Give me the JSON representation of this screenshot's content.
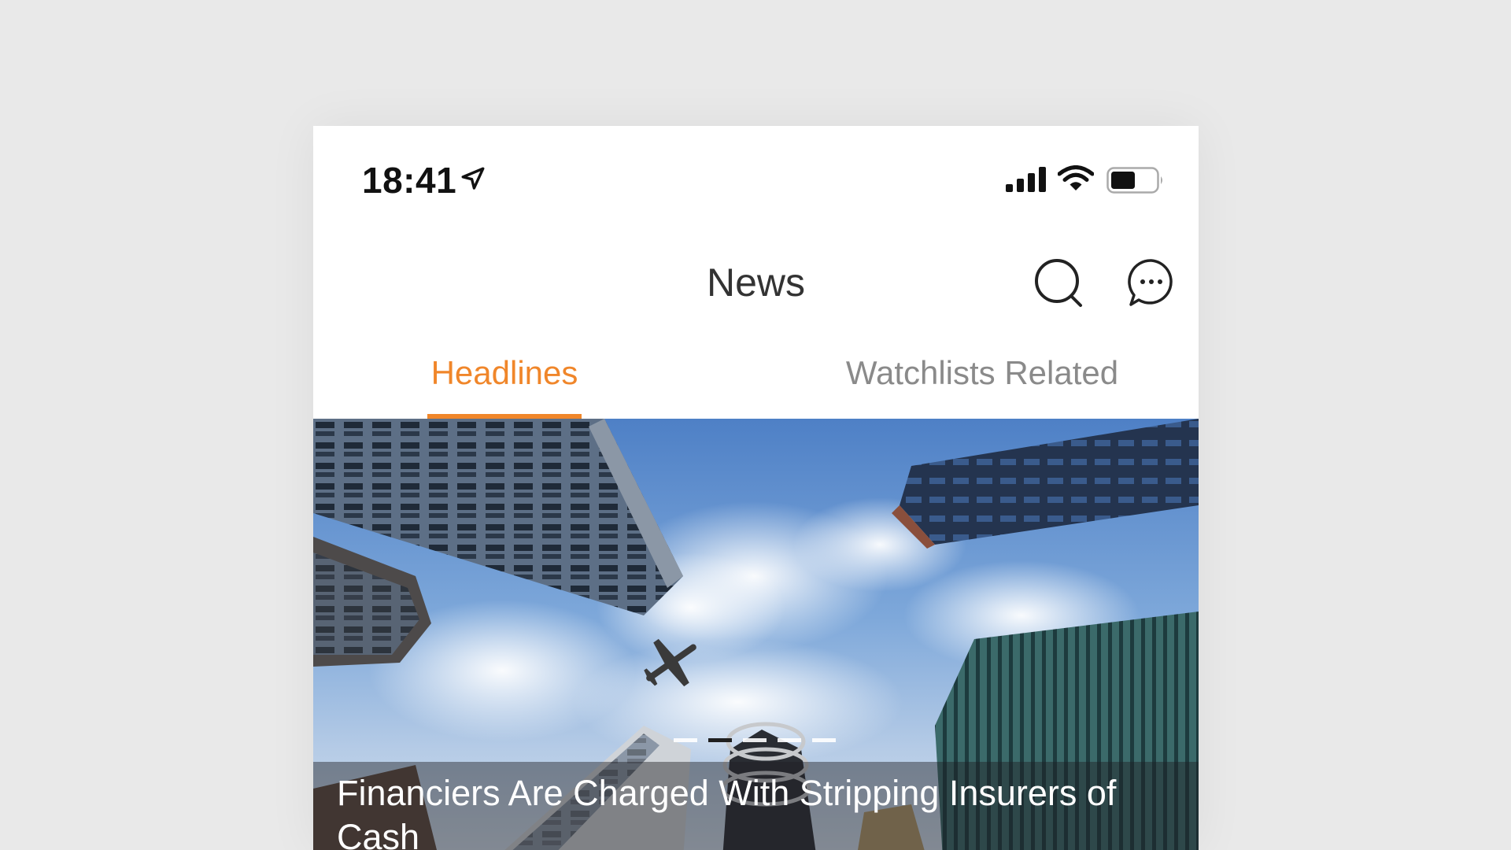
{
  "status_bar": {
    "time": "18:41"
  },
  "nav": {
    "title": "News"
  },
  "tabs": [
    {
      "label": "Headlines",
      "active": true
    },
    {
      "label": "Watchlists Related",
      "active": false
    }
  ],
  "hero": {
    "headline": "Financiers Are Charged With Stripping Insurers of Cash",
    "carousel": {
      "count": 5,
      "active_index": 1
    }
  },
  "colors": {
    "accent": "#f0862a",
    "inactive_tab": "#8a8a8a",
    "background": "#e9e9e9"
  },
  "icons": [
    "location-arrow-icon",
    "signal-icon",
    "wifi-icon",
    "battery-icon",
    "search-icon",
    "chat-more-icon"
  ]
}
